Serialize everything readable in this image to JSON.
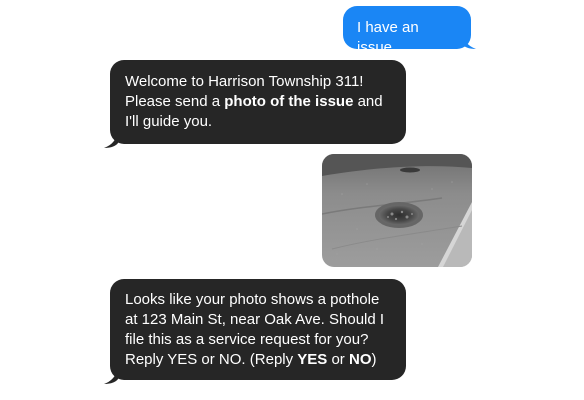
{
  "conversation": {
    "messages": [
      {
        "direction": "outgoing",
        "type": "text",
        "text": "I have an issue"
      },
      {
        "direction": "incoming",
        "type": "text",
        "line1": "Welcome to Harrison Township 311!",
        "line2_prefix": "Please send a ",
        "line2_bold": "photo of the issue",
        "line2_suffix": " and",
        "line3": "I'll guide you."
      },
      {
        "direction": "outgoing",
        "type": "photo",
        "icon": "pothole-photo"
      },
      {
        "direction": "incoming",
        "type": "text",
        "line1": "Looks like your photo shows a pothole",
        "line2": "at 123 Main St, near Oak Ave. Should I",
        "line3": "file this as a service request for you?",
        "line4_prefix": "Reply YES or NO. (Reply ",
        "line4_bold1": "YES",
        "line4_mid": " or ",
        "line4_bold2": "NO",
        "line4_suffix": ")"
      }
    ]
  },
  "colors": {
    "outgoing_bubble": "#1a86f5",
    "incoming_bubble": "#262626",
    "background": "#ffffff"
  }
}
